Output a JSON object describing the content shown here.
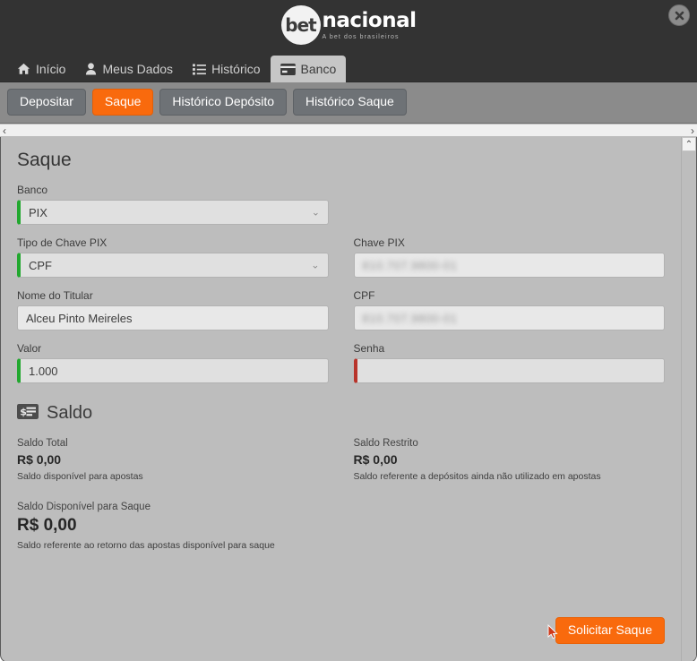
{
  "header": {
    "logo_bet": "bet",
    "logo_nacional": "nacional",
    "logo_tagline": "A bet dos brasileiros",
    "close_icon": "close-icon"
  },
  "nav": {
    "items": [
      {
        "label": "Início",
        "icon": "home-icon",
        "active": false
      },
      {
        "label": "Meus Dados",
        "icon": "user-icon",
        "active": false
      },
      {
        "label": "Histórico",
        "icon": "list-icon",
        "active": false
      },
      {
        "label": "Banco",
        "icon": "card-icon",
        "active": true
      }
    ]
  },
  "subtabs": {
    "items": [
      {
        "label": "Depositar",
        "active": false
      },
      {
        "label": "Saque",
        "active": true
      },
      {
        "label": "Histórico Depósito",
        "active": false
      },
      {
        "label": "Histórico Saque",
        "active": false
      }
    ]
  },
  "scrollbars": {
    "left_arrow": "‹",
    "right_arrow": "›",
    "up_arrow": "⌃"
  },
  "form": {
    "title": "Saque",
    "banco": {
      "label": "Banco",
      "value": "PIX",
      "state": "valid",
      "chevron": "⌄"
    },
    "tipo_chave": {
      "label": "Tipo de Chave PIX",
      "value": "CPF",
      "state": "valid",
      "chevron": "⌄"
    },
    "chave_pix": {
      "label": "Chave PIX",
      "value": "810.707.9800-01",
      "redacted": true,
      "state": "plain"
    },
    "nome_titular": {
      "label": "Nome do Titular",
      "value": "Alceu  Pinto Meireles",
      "state": "plain"
    },
    "cpf": {
      "label": "CPF",
      "value": "810.707.9800-01",
      "redacted": true,
      "state": "plain"
    },
    "valor": {
      "label": "Valor",
      "value": "1.000",
      "state": "valid"
    },
    "senha": {
      "label": "Senha",
      "value": "",
      "state": "invalid"
    }
  },
  "saldo": {
    "title": "Saldo",
    "icon": "money-card-icon",
    "items": [
      {
        "label": "Saldo Total",
        "value": "R$ 0,00",
        "note": "Saldo disponível para apostas",
        "size": "normal"
      },
      {
        "label": "Saldo Restrito",
        "value": "R$ 0,00",
        "note": "Saldo referente a depósitos ainda não utilizado em apostas",
        "size": "normal"
      },
      {
        "label": "Saldo Disponível para Saque",
        "value": "R$ 0,00",
        "note": "Saldo referente ao retorno das apostas disponível para saque",
        "size": "big"
      }
    ]
  },
  "actions": {
    "submit_label": "Solicitar Saque"
  },
  "colors": {
    "accent_orange": "#f96a0d",
    "valid_green": "#22a82f",
    "invalid_red": "#b8342b",
    "header_dark": "#333333",
    "panel_gray": "#bdbdbd"
  }
}
